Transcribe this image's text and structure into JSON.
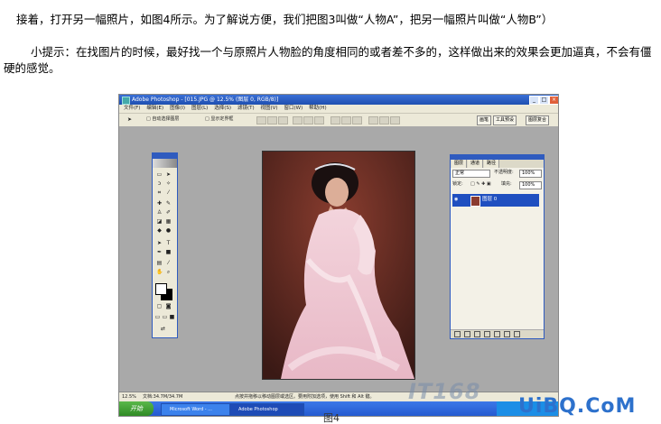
{
  "article": {
    "paragraph1": "接着，打开另一幅照片，如图4所示。为了解说方便，我们把图3叫做“人物A”，把另一幅照片叫做“人物B”）",
    "paragraph2": "小提示：在找图片的时候，最好找一个与原照片人物脸的角度相同的或者差不多的，这样做出来的效果会更加逼真，不会有僵硬的感觉。",
    "caption": "图4"
  },
  "photoshop": {
    "title": "Adobe Photoshop - [015.JPG @ 12.5% (图层 0, RGB/8)]",
    "window_buttons": [
      "_",
      "□",
      "×"
    ],
    "menu": [
      "文件(F)",
      "编辑(E)",
      "图像(I)",
      "图层(L)",
      "选择(S)",
      "滤镜(T)",
      "视图(V)",
      "窗口(W)",
      "帮助(H)"
    ],
    "options": {
      "auto_select": "自动选择图层",
      "show_bounds": "显示定界框"
    },
    "palette_tabs": [
      "画笔",
      "工具预设",
      "图层复合"
    ],
    "layers_panel": {
      "tabs": [
        "图层",
        "通道",
        "路径"
      ],
      "blend_mode": "正常",
      "opacity_label": "不透明度:",
      "opacity_value": "100%",
      "lock_label": "锁定:",
      "fill_label": "填充:",
      "fill_value": "100%",
      "layer_name": "图层 0"
    },
    "status": {
      "zoom": "12.5%",
      "doc": "文档:34.7M/34.7M",
      "hint": "点按并拖移以移动图层或选区。要用附加选项，使用 Shift 和 Alt 键。"
    }
  },
  "taskbar": {
    "start": "开始",
    "tasks": [
      "Microsoft Word - ...",
      "Adobe Photoshop"
    ]
  },
  "watermark": {
    "left": "IT168",
    "right": "UiBQ.CoM"
  },
  "colors": {
    "title_bar": "#1e4fb0",
    "photo_background": "#5a2a22",
    "selected_layer": "#1f4fc0",
    "watermark": "#2d71cc"
  }
}
